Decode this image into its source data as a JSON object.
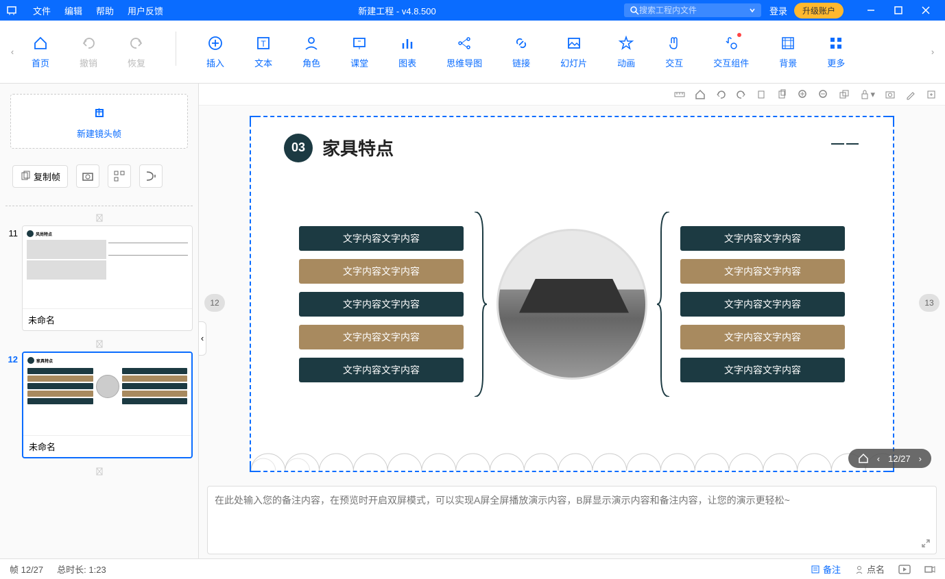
{
  "titlebar": {
    "menu": {
      "file": "文件",
      "edit": "编辑",
      "help": "帮助",
      "feedback": "用户反馈"
    },
    "title": "新建工程 - v4.8.500",
    "search_placeholder": "搜索工程内文件",
    "login": "登录",
    "upgrade": "升级账户"
  },
  "ribbon": {
    "home": "首页",
    "undo": "撤销",
    "redo": "恢复",
    "insert": "插入",
    "text": "文本",
    "role": "角色",
    "classroom": "课堂",
    "chart": "图表",
    "mindmap": "思维导图",
    "link": "链接",
    "slideshow": "幻灯片",
    "animation": "动画",
    "interact": "交互",
    "components": "交互组件",
    "background": "背景",
    "more": "更多"
  },
  "sidebar": {
    "new_frame": "新建镜头帧",
    "copy_frame": "复制帧",
    "slides": [
      {
        "num": "11",
        "name": "未命名"
      },
      {
        "num": "12",
        "name": "未命名"
      }
    ]
  },
  "canvas": {
    "prev_num": "12",
    "next_num": "13",
    "slide_number": "03",
    "slide_title": "家具特点",
    "box_text": "文字内容文字内容",
    "page_indicator": "12/27"
  },
  "notes": {
    "placeholder": "在此处输入您的备注内容，在预览时开启双屏模式，可以实现A屏全屏播放演示内容，B屏显示演示内容和备注内容，让您的演示更轻松~"
  },
  "status": {
    "frame": "帧 12/27",
    "duration": "总时长: 1:23",
    "notes": "备注",
    "roll": "点名"
  }
}
